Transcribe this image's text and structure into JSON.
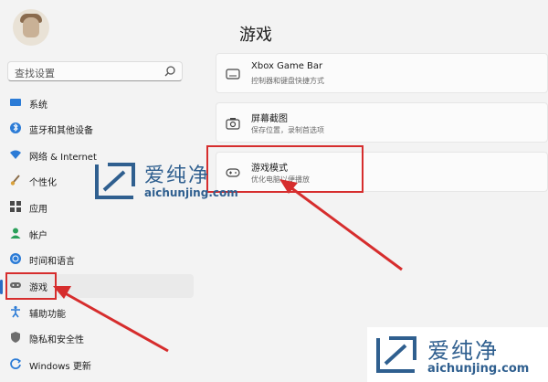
{
  "sidebar": {
    "search_placeholder": "查找设置",
    "items": [
      {
        "label": "系统",
        "icon": "monitor-icon"
      },
      {
        "label": "蓝牙和其他设备",
        "icon": "bluetooth-icon"
      },
      {
        "label": "网络 & Internet",
        "icon": "wifi-icon"
      },
      {
        "label": "个性化",
        "icon": "brush-icon"
      },
      {
        "label": "应用",
        "icon": "apps-icon"
      },
      {
        "label": "帐户",
        "icon": "person-icon"
      },
      {
        "label": "时间和语言",
        "icon": "globe-clock-icon"
      },
      {
        "label": "游戏",
        "icon": "gamepad-icon"
      },
      {
        "label": "辅助功能",
        "icon": "accessibility-icon"
      },
      {
        "label": "隐私和安全性",
        "icon": "shield-icon"
      },
      {
        "label": "Windows 更新",
        "icon": "update-icon"
      }
    ],
    "active_index": 7
  },
  "main": {
    "title": "游戏",
    "cards": [
      {
        "title": "Xbox Game Bar",
        "desc": "控制器和键盘快捷方式",
        "icon": "xbox-gamebar-icon"
      },
      {
        "title": "屏幕截图",
        "desc": "保存位置，录制首选项",
        "icon": "camera-icon"
      },
      {
        "title": "游戏模式",
        "desc": "优化电脑以便播放",
        "icon": "gamepad-icon"
      }
    ]
  },
  "watermark": {
    "cn": "爱纯净",
    "url": "aichunjing.com"
  },
  "colors": {
    "highlight": "#d62d2d",
    "accent": "#2b6cc4",
    "watermark": "#2f5f8f"
  }
}
